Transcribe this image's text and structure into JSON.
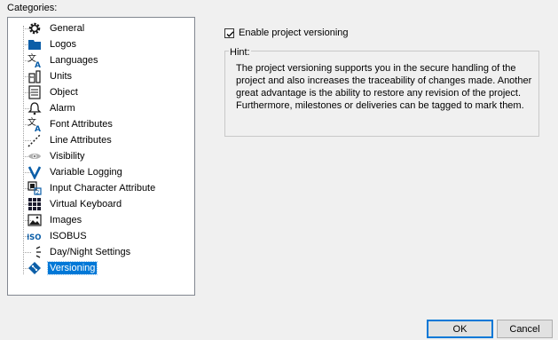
{
  "categories_label": "Categories:",
  "tree": {
    "items": [
      {
        "label": "General",
        "icon": "gear-icon"
      },
      {
        "label": "Logos",
        "icon": "folder-icon"
      },
      {
        "label": "Languages",
        "icon": "language-icon"
      },
      {
        "label": "Units",
        "icon": "units-icon"
      },
      {
        "label": "Object",
        "icon": "object-icon"
      },
      {
        "label": "Alarm",
        "icon": "bell-icon"
      },
      {
        "label": "Font Attributes",
        "icon": "font-attributes-icon"
      },
      {
        "label": "Line Attributes",
        "icon": "line-attributes-icon"
      },
      {
        "label": "Visibility",
        "icon": "eye-icon"
      },
      {
        "label": "Variable Logging",
        "icon": "variable-logging-icon"
      },
      {
        "label": "Input Character Attribute",
        "icon": "input-character-icon"
      },
      {
        "label": "Virtual Keyboard",
        "icon": "keyboard-icon"
      },
      {
        "label": "Images",
        "icon": "image-icon"
      },
      {
        "label": "ISOBUS",
        "icon": "isobus-icon"
      },
      {
        "label": "Day/Night Settings",
        "icon": "day-night-icon"
      },
      {
        "label": "Versioning",
        "icon": "versioning-icon"
      }
    ],
    "selected": "Versioning"
  },
  "versioning": {
    "enable_label": "Enable project versioning",
    "enable_checked": true,
    "hint_title": "Hint:",
    "hint_text": "The project versioning supports you in the secure handling of the project and also increases the traceability of changes made. Another great advantage is the ability to restore any revision of the project. Furthermore, milestones or deliveries can be tagged to mark them."
  },
  "buttons": {
    "ok": "OK",
    "cancel": "Cancel"
  },
  "colors": {
    "selection": "#0078d7",
    "icon_dark": "#1a1a2e",
    "icon_blue": "#0b5ea8"
  }
}
